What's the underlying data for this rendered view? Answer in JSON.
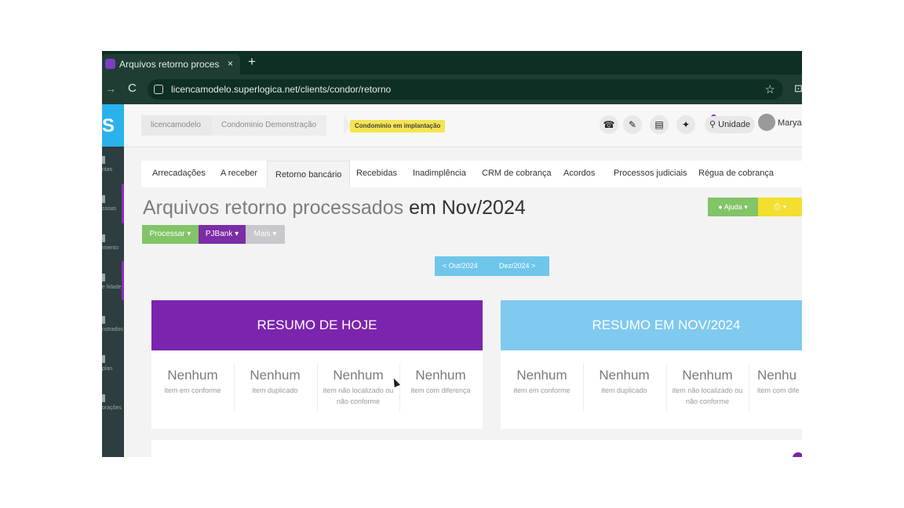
{
  "browser": {
    "tab_title": "Arquivos retorno processados",
    "tab_close": "×",
    "new_tab": "+",
    "back_glyph": "→",
    "reload_glyph": "C",
    "url": "licencamodelo.superlogica.net/clients/condor/retorno",
    "star_glyph": "☆",
    "ext_glyph": "⊡"
  },
  "sidebar": {
    "logo": "S",
    "items": [
      {
        "label": "ntas"
      },
      {
        "label": "ssoas"
      },
      {
        "label": "imento"
      },
      {
        "label": "e lidade"
      },
      {
        "label": "nstrados"
      },
      {
        "label": "plan"
      },
      {
        "label": "orações"
      }
    ]
  },
  "header": {
    "breadcrumb": [
      "licencamodelo",
      "Condominio Demonstração"
    ],
    "badge": "Condominio em implantação",
    "icons": {
      "phone": "☎",
      "ticket": "✎",
      "card": "▤",
      "gift": "✦"
    },
    "unit_button": "Unidade",
    "user": "Maryan"
  },
  "menu": {
    "tabs": [
      {
        "label": "Arrecadações"
      },
      {
        "label": "A receber"
      },
      {
        "label": "Retorno bancário"
      },
      {
        "label": "Recebidas"
      },
      {
        "label": "Inadimplência"
      },
      {
        "label": "CRM de cobrança"
      },
      {
        "label": "Acordos"
      },
      {
        "label": "Processos judiciais"
      },
      {
        "label": "Régua de cobrança"
      }
    ],
    "active_index": 2
  },
  "page": {
    "title": "Arquivos retorno processados",
    "period": "em Nov/2024",
    "help_button": "Ajuda",
    "print_glyph": "⎙",
    "buttons": {
      "processar": "Processar",
      "pjbank": "PJBank",
      "mais": "Mais"
    },
    "prev_period": "< Out/2024",
    "next_period": "Dez/2024 >"
  },
  "cards": {
    "today": {
      "title": "RESUMO DE HOJE",
      "stats": [
        {
          "value": "Nenhum",
          "label": "item em conforme"
        },
        {
          "value": "Nenhum",
          "label": "item duplicado"
        },
        {
          "value": "Nenhum",
          "label": "item não localizado ou não conforme"
        },
        {
          "value": "Nenhum",
          "label": "item com diferença"
        }
      ]
    },
    "month": {
      "title": "RESUMO EM NOV/2024",
      "stats": [
        {
          "value": "Nenhum",
          "label": "item em conforme"
        },
        {
          "value": "Nenhum",
          "label": "item duplicado"
        },
        {
          "value": "Nenhum",
          "label": "item não localizado ou não conforme"
        },
        {
          "value": "Nenhu",
          "label": "item com dife"
        }
      ]
    }
  },
  "colors": {
    "purple": "#7b24ad",
    "light_blue": "#80c9ef",
    "green": "#82c468",
    "yellow": "#f3df2e",
    "browser_dark": "#0e2f23"
  }
}
